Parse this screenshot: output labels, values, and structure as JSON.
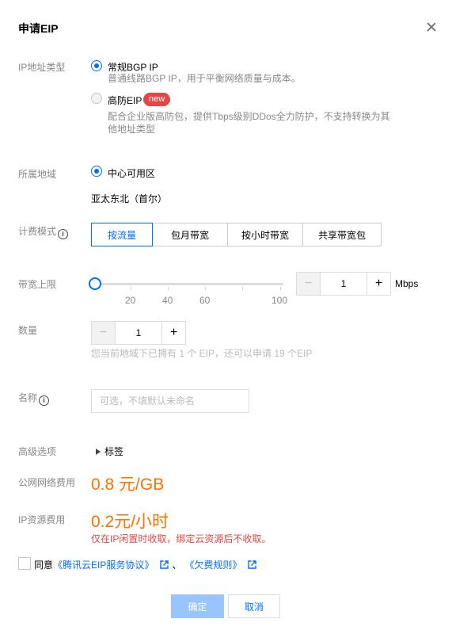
{
  "dialog": {
    "title": "申请EIP"
  },
  "ip_type": {
    "label": "IP地址类型",
    "options": [
      {
        "title": "常规BGP IP",
        "desc": "普通线路BGP IP，用于平衡网络质量与成本。",
        "selected": true
      },
      {
        "title": "高防EIP",
        "badge": "new",
        "desc_line1": "配合企业版高防包，提供Tbps级别DDos全力防护，不支持转换为其",
        "desc_line2": "他地址类型",
        "selected": false
      }
    ]
  },
  "region": {
    "label": "所属地域",
    "option": "中心可用区",
    "selected": true,
    "value": "亚太东北（首尔）"
  },
  "billing": {
    "label": "计费模式",
    "options": [
      "按流量",
      "包月带宽",
      "按小时带宽",
      "共享带宽包"
    ],
    "selected_index": 0
  },
  "bandwidth": {
    "label": "带宽上限",
    "ticks": [
      "20",
      "40",
      "60",
      "100"
    ],
    "value": "1",
    "unit": "Mbps",
    "slider_fraction": 0.0
  },
  "quantity": {
    "label": "数量",
    "value": "1",
    "hint": "您当前地域下已拥有 1 个 EIP，还可以申请 19 个EIP"
  },
  "name": {
    "label": "名称",
    "placeholder": "可选，不填默认未命名"
  },
  "advanced": {
    "label": "高级选项",
    "toggle": "标签"
  },
  "network_fee": {
    "label": "公网网络费用",
    "price": "0.8 元/GB"
  },
  "ip_fee": {
    "label": "IP资源费用",
    "price": "0.2元/小时",
    "note": "仅在IP闲置时收取，绑定云资源后不收取。"
  },
  "agreement": {
    "prefix": "同意",
    "link1": "《腾讯云EIP服务协议》",
    "sep": "、",
    "link2": "《欠费规则》"
  },
  "footer": {
    "ok": "确定",
    "cancel": "取消"
  },
  "colors": {
    "accent": "#006eff",
    "price": "#ff7200",
    "danger": "#e54545"
  }
}
